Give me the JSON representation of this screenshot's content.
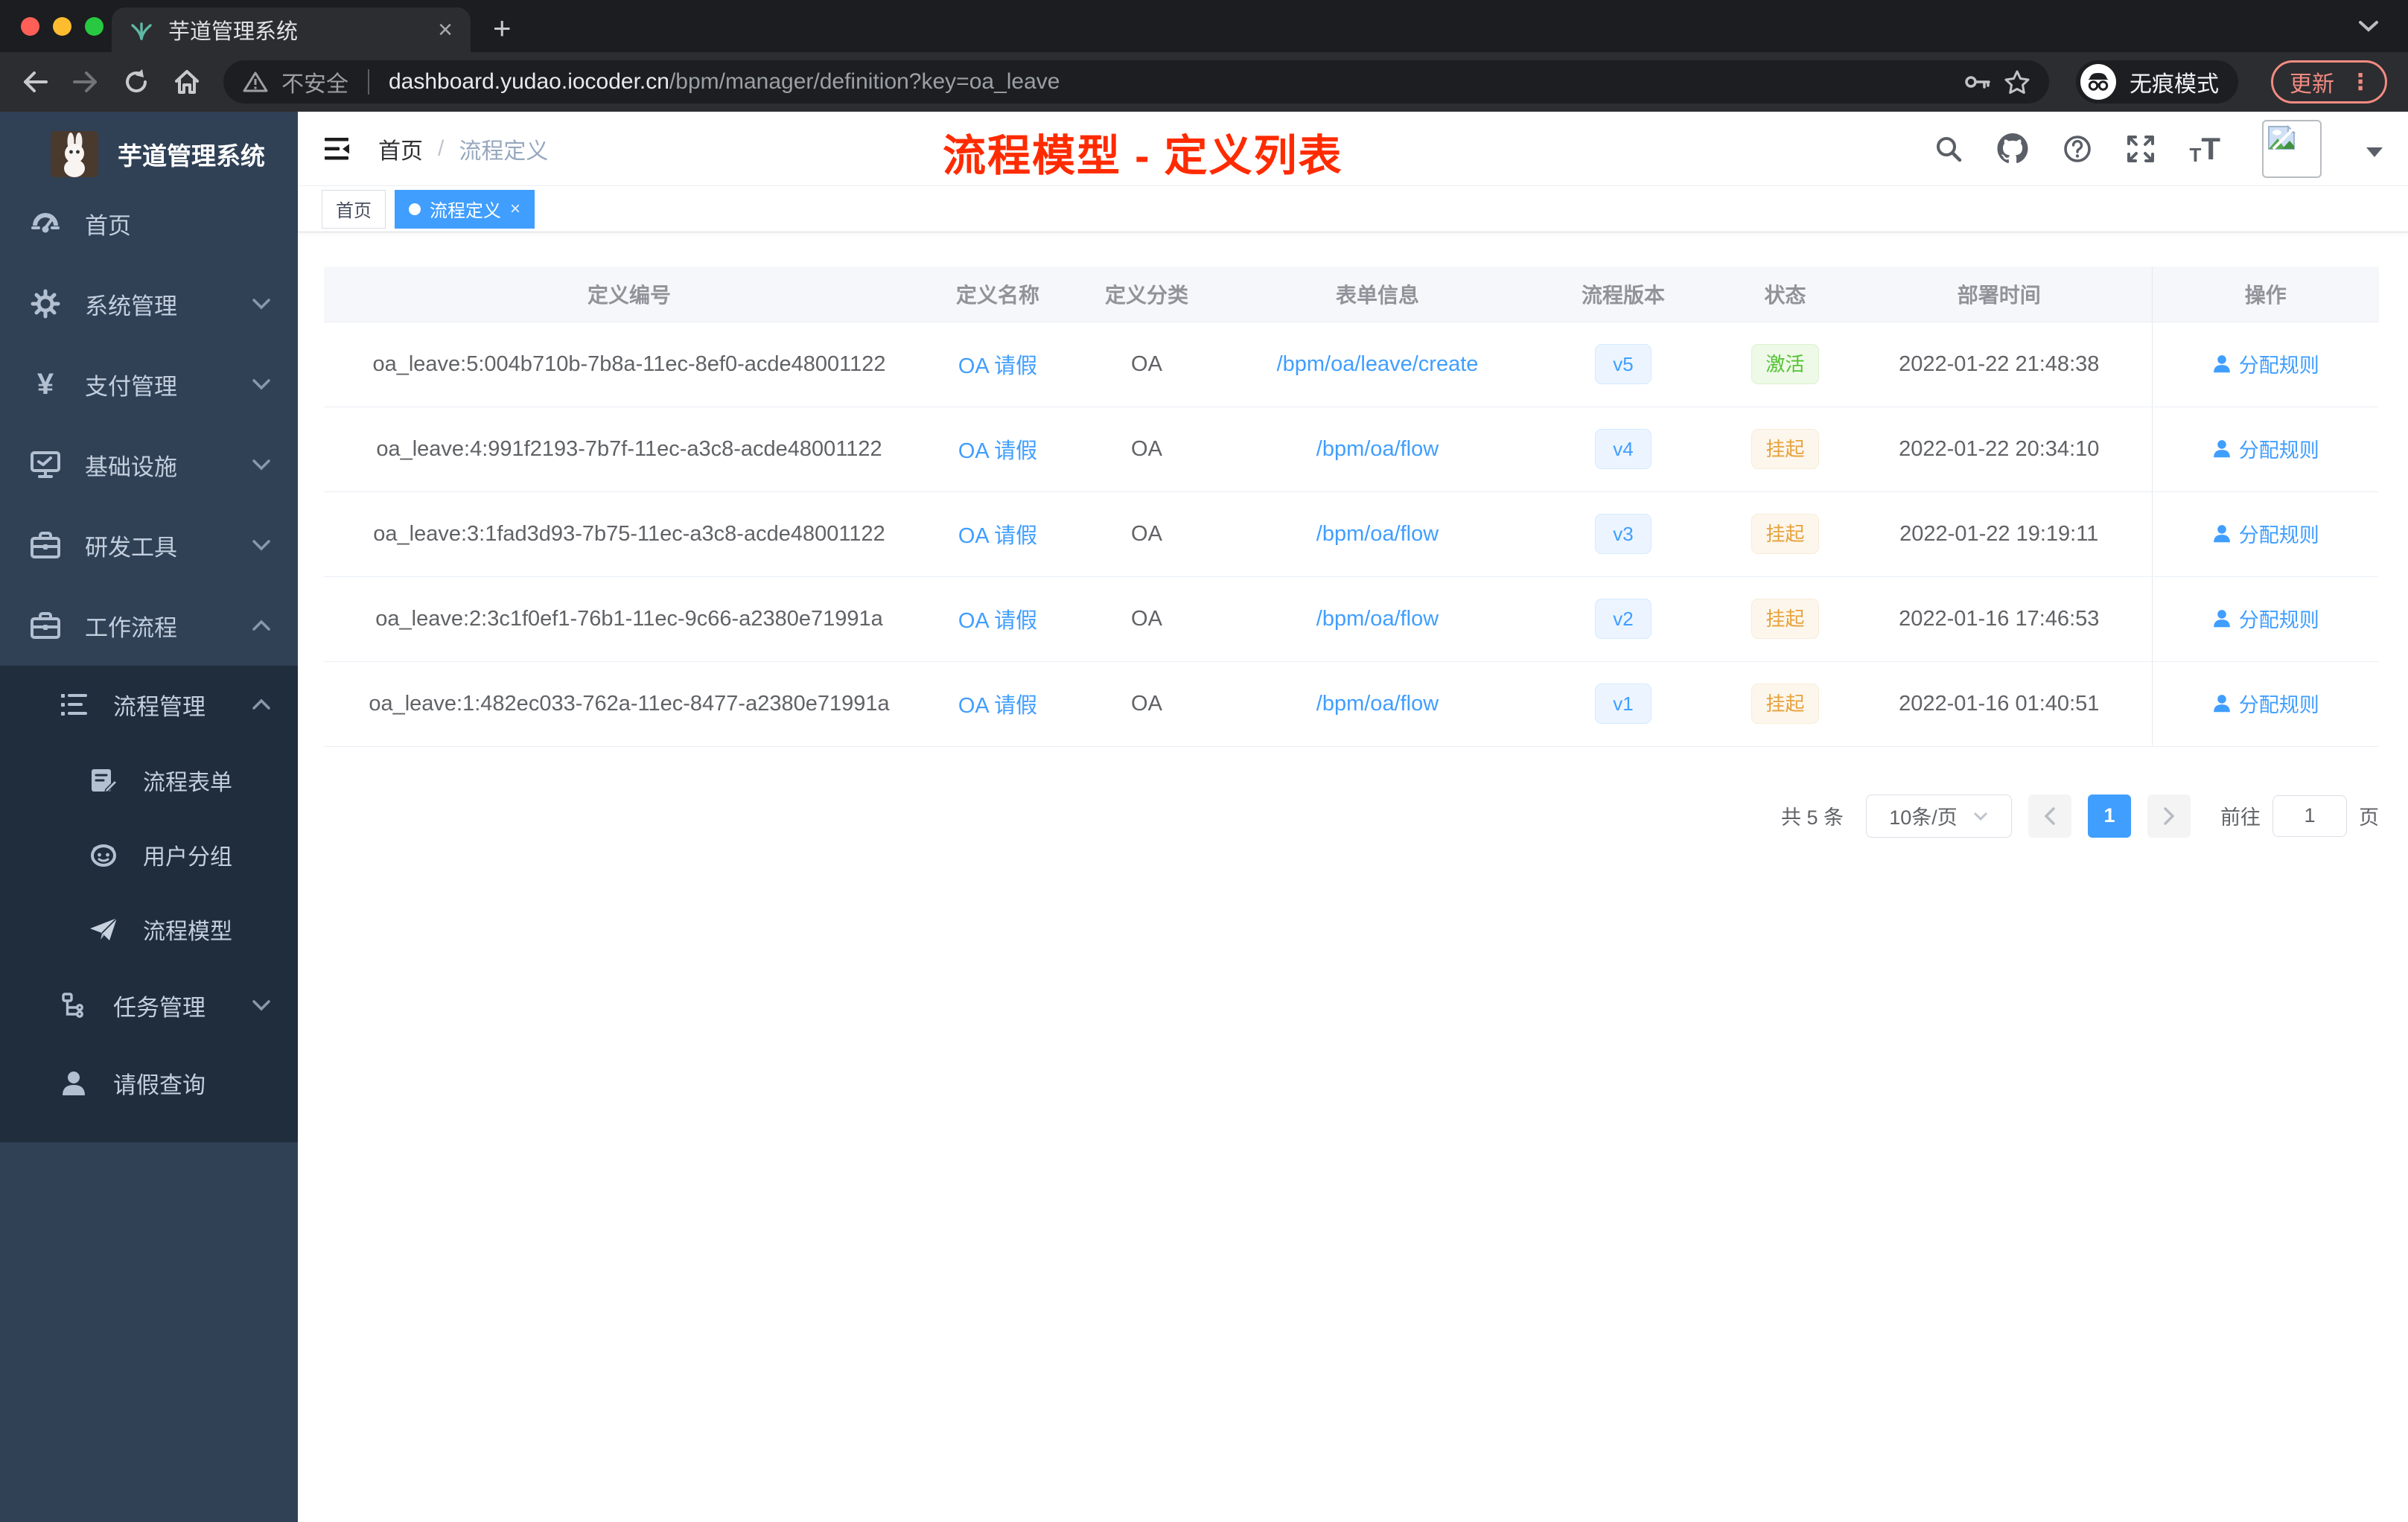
{
  "browser": {
    "tab_title": "芋道管理系统",
    "new_tab_label": "+",
    "security_label": "不安全",
    "url_domain": "dashboard.yudao.iocoder.cn",
    "url_path": "/bpm/manager/definition?key=oa_leave",
    "incognito_label": "无痕模式",
    "update_label": "更新"
  },
  "sidebar": {
    "brand": "芋道管理系统",
    "items": [
      {
        "label": "首页",
        "icon": "dashboard-icon"
      },
      {
        "label": "系统管理",
        "icon": "gear-icon",
        "state": "collapsed"
      },
      {
        "label": "支付管理",
        "icon": "yen-icon",
        "state": "collapsed"
      },
      {
        "label": "基础设施",
        "icon": "monitor-icon",
        "state": "collapsed"
      },
      {
        "label": "研发工具",
        "icon": "toolbox-icon",
        "state": "collapsed"
      },
      {
        "label": "工作流程",
        "icon": "briefcase-icon",
        "state": "expanded",
        "children": [
          {
            "label": "流程管理",
            "icon": "list-icon",
            "state": "expanded",
            "children": [
              {
                "label": "流程表单",
                "icon": "form-icon"
              },
              {
                "label": "用户分组",
                "icon": "group-icon"
              },
              {
                "label": "流程模型",
                "icon": "paper-plane-icon"
              }
            ]
          },
          {
            "label": "任务管理",
            "icon": "tree-icon",
            "state": "collapsed"
          },
          {
            "label": "请假查询",
            "icon": "user-icon"
          }
        ]
      }
    ]
  },
  "header": {
    "breadcrumb": {
      "home": "首页",
      "separator": "/",
      "current": "流程定义"
    },
    "annotation": "流程模型 - 定义列表"
  },
  "tags": [
    {
      "label": "首页",
      "active": false
    },
    {
      "label": "流程定义",
      "active": true,
      "close": "×"
    }
  ],
  "table": {
    "columns": [
      "定义编号",
      "定义名称",
      "定义分类",
      "表单信息",
      "流程版本",
      "状态",
      "部署时间",
      "操作"
    ],
    "rows": [
      {
        "id": "oa_leave:5:004b710b-7b8a-11ec-8ef0-acde48001122",
        "name": "OA 请假",
        "category": "OA",
        "form": "/bpm/oa/leave/create",
        "version": "v5",
        "status": "激活",
        "status_type": "success",
        "time": "2022-01-22 21:48:38",
        "action": "分配规则"
      },
      {
        "id": "oa_leave:4:991f2193-7b7f-11ec-a3c8-acde48001122",
        "name": "OA 请假",
        "category": "OA",
        "form": "/bpm/oa/flow",
        "version": "v4",
        "status": "挂起",
        "status_type": "warning",
        "time": "2022-01-22 20:34:10",
        "action": "分配规则"
      },
      {
        "id": "oa_leave:3:1fad3d93-7b75-11ec-a3c8-acde48001122",
        "name": "OA 请假",
        "category": "OA",
        "form": "/bpm/oa/flow",
        "version": "v3",
        "status": "挂起",
        "status_type": "warning",
        "time": "2022-01-22 19:19:11",
        "action": "分配规则"
      },
      {
        "id": "oa_leave:2:3c1f0ef1-76b1-11ec-9c66-a2380e71991a",
        "name": "OA 请假",
        "category": "OA",
        "form": "/bpm/oa/flow",
        "version": "v2",
        "status": "挂起",
        "status_type": "warning",
        "time": "2022-01-16 17:46:53",
        "action": "分配规则"
      },
      {
        "id": "oa_leave:1:482ec033-762a-11ec-8477-a2380e71991a",
        "name": "OA 请假",
        "category": "OA",
        "form": "/bpm/oa/flow",
        "version": "v1",
        "status": "挂起",
        "status_type": "warning",
        "time": "2022-01-16 01:40:51",
        "action": "分配规则"
      }
    ]
  },
  "pagination": {
    "total_label": "共 5 条",
    "page_size": "10条/页",
    "current_page": "1",
    "goto_label": "前往",
    "goto_value": "1",
    "page_suffix": "页"
  },
  "colors": {
    "accent_blue": "#409eff",
    "success_green": "#54c332",
    "warning_orange": "#e6a23c",
    "annotation_red": "#ff2b00",
    "sidebar_bg": "#304156",
    "submenu_bg": "#1f2d3d"
  }
}
